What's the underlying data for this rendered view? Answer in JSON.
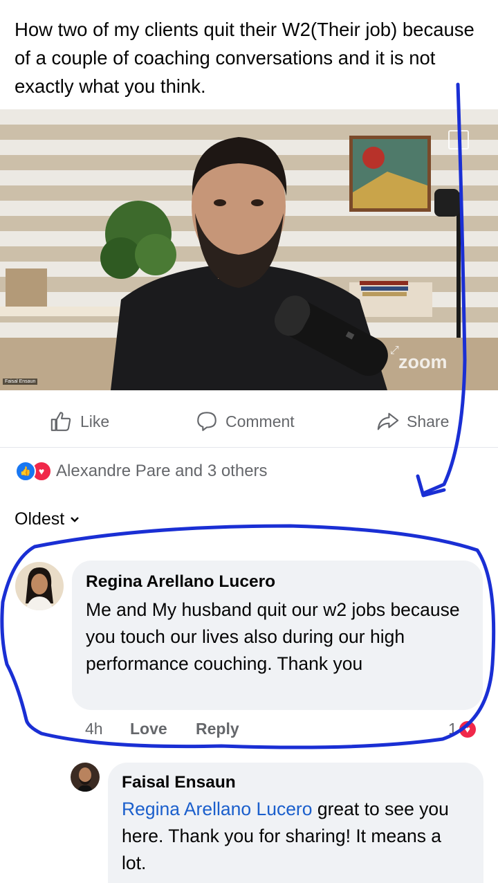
{
  "post": {
    "text": "How two of my clients quit their W2(Their job) because of a couple of coaching conversations and it is not exactly what you think."
  },
  "video": {
    "speaker_name": "Faisal Ensaun",
    "logo": "zoom"
  },
  "actions": {
    "like": "Like",
    "comment": "Comment",
    "share": "Share"
  },
  "reactions": {
    "text": "Alexandre Pare and 3 others",
    "icons": [
      "like-icon",
      "love-icon"
    ]
  },
  "sort": {
    "label": "Oldest"
  },
  "comments": [
    {
      "author": "Regina Arellano Lucero",
      "text": "Me and My husband quit our w2 jobs because you touch our lives also during our high performance couching. Thank you",
      "time": "4h",
      "reaction_label": "Love",
      "reply_label": "Reply",
      "reaction_count": "1"
    },
    {
      "author": "Faisal Ensaun",
      "mention": "Regina Arellano Lucero",
      "text": " great to see you here. Thank you for sharing! It means a lot."
    }
  ],
  "colors": {
    "accent_blue": "#1877f2",
    "love_red": "#f0284a",
    "annotation_blue": "#1a2fd4",
    "muted_text": "#65676b",
    "bubble_bg": "#f0f2f5"
  }
}
